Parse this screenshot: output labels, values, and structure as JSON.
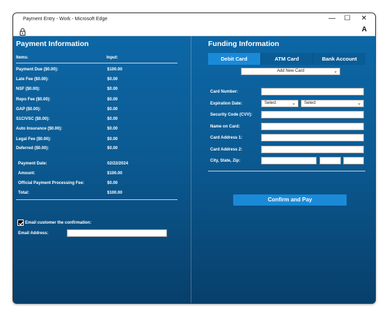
{
  "window": {
    "title": "Payment Entry - Work - Microsoft Edge",
    "controls": {
      "minimize": "—",
      "maximize": "☐",
      "close": "✕"
    },
    "reader_icon": "A"
  },
  "payment": {
    "heading": "Payment Information",
    "col_items": "Items:",
    "col_input": "Input:",
    "items": [
      {
        "label": "Payment Due ($0.00):",
        "value": "$100.00"
      },
      {
        "label": "Late Fee ($0.00):",
        "value": "$0.00"
      },
      {
        "label": "NSF ($0.00):",
        "value": "$0.00"
      },
      {
        "label": "Repo Fee ($0.00):",
        "value": "$0.00"
      },
      {
        "label": "GAP ($0.00):",
        "value": "$0.00"
      },
      {
        "label": "S1C/VSC ($0.00):",
        "value": "$0.00"
      },
      {
        "label": "Auto Insurance ($0.00):",
        "value": "$0.00"
      },
      {
        "label": "Legal Fee ($0.00):",
        "value": "$0.00"
      },
      {
        "label": "Deferred ($0.00):",
        "value": "$0.00"
      }
    ],
    "summary": [
      {
        "label": "Payment Date:",
        "value": "02/22/2024"
      },
      {
        "label": "Amount:",
        "value": "$100.00"
      },
      {
        "label": "Official Payment Processing Fee:",
        "value": "$0.00"
      },
      {
        "label": "Total:",
        "value": "$100.00"
      }
    ],
    "email_confirm_label": "Email customer the confirmation:",
    "email_confirm_checked": true,
    "email_address_label": "Email Address:",
    "email_address_value": ""
  },
  "funding": {
    "heading": "Funding Information",
    "tabs": [
      {
        "label": "Debit Card",
        "active": true
      },
      {
        "label": "ATM Card",
        "active": false
      },
      {
        "label": "Bank Account",
        "active": false
      }
    ],
    "card_select": "Add New Card",
    "fields": {
      "card_number": "Card Number:",
      "expiration": "Expiration Date:",
      "expiration_month": "Select",
      "expiration_year": "Select",
      "cvv": "Security Code (CVV):",
      "name_on_card": "Name on Card:",
      "address1": "Card Address 1:",
      "address2": "Card Address 2:",
      "city_state_zip": "City, State, Zip:"
    },
    "confirm_button": "Confirm and Pay"
  },
  "colors": {
    "background_top": "#0d67a6",
    "background_bottom": "#083f6b",
    "active_tab": "#1a8ad8",
    "button": "#1a8ad8"
  }
}
